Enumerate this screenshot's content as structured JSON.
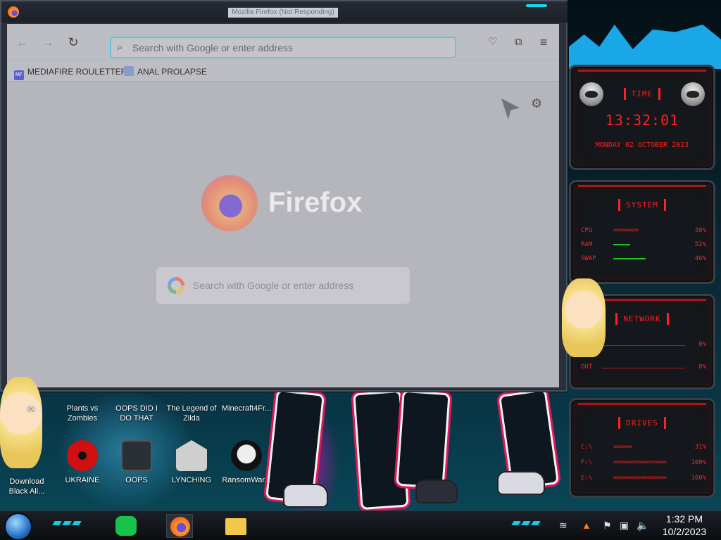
{
  "window": {
    "title": "Mozilla Firefox (Not Responding)"
  },
  "browser": {
    "url_placeholder": "Search with Google or enter address",
    "bookmarks": [
      "MEDIAFIRE ROULETTER",
      "ANAL PROLAPSE"
    ],
    "bookmark_favicons": [
      "MF",
      ""
    ],
    "newtab_brand": "Firefox",
    "newtab_search_placeholder": "Search with Google or enter address"
  },
  "widgets": {
    "time": {
      "title": "TIME",
      "clock": "13:32:01",
      "date": "MONDAY 02 OCTOBER 2023"
    },
    "system": {
      "title": "SYSTEM",
      "rows": [
        {
          "label": "CPU",
          "value": "38%"
        },
        {
          "label": "RAM",
          "value": "52%"
        },
        {
          "label": "SWAP",
          "value": "46%"
        }
      ]
    },
    "network": {
      "title": "NETWORK",
      "rows": [
        {
          "label": "IN",
          "value": "0%"
        },
        {
          "label": "OUT",
          "value": "0%"
        }
      ]
    },
    "drives": {
      "title": "DRIVES",
      "rows": [
        {
          "label": "C:\\",
          "value": "31%"
        },
        {
          "label": "F:\\",
          "value": "100%"
        },
        {
          "label": "E:\\",
          "value": "100%"
        }
      ]
    }
  },
  "desktop_icons": {
    "row1": [
      "IN",
      "Plants vs Zombies",
      "OOPS DID I DO THAT",
      "The Legend of Zilda",
      "Minecraft4Fr..."
    ],
    "row2": [
      "Download Black Ali...",
      "UKRAINE",
      "OOPS",
      "LYNCHING",
      "RansomWar..."
    ]
  },
  "taskbar": {
    "time": "1:32 PM",
    "date": "10/2/2023"
  },
  "colors": {
    "widget_accent": "#ff2020",
    "taskbar_accent": "#18c9e0",
    "urlbar_focus": "#5ec7dc"
  }
}
